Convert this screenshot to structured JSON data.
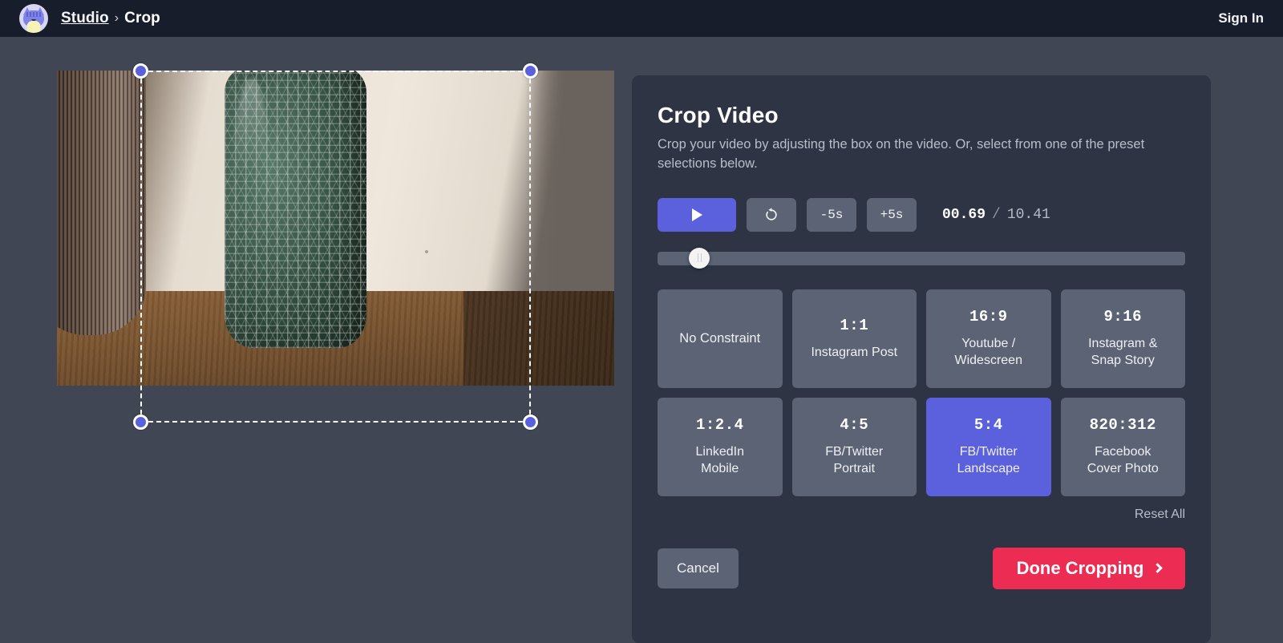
{
  "header": {
    "avatar_icon": "cat-avatar-icon",
    "breadcrumb_root": "Studio",
    "breadcrumb_separator": "›",
    "breadcrumb_current": "Crop",
    "sign_in": "Sign In"
  },
  "stage": {
    "scene_description": "Green textured ceramic vase on wooden table with ribbed brown vase at left"
  },
  "panel": {
    "title": "Crop Video",
    "subtitle": "Crop your video by adjusting the box on the video. Or, select from one of the preset selections below.",
    "controls": {
      "play_icon": "play-icon",
      "restart_icon": "restart-icon",
      "back5_label": "-5s",
      "forward5_label": "+5s",
      "current_time": "00.69",
      "time_separator": "/",
      "duration": "10.41"
    },
    "scrubber": {
      "position_percent": 6
    },
    "presets": [
      {
        "ratio": "",
        "name": "No Constraint",
        "active": false
      },
      {
        "ratio": "1:1",
        "name": "Instagram Post",
        "active": false
      },
      {
        "ratio": "16:9",
        "name": "Youtube /\nWidescreen",
        "active": false
      },
      {
        "ratio": "9:16",
        "name": "Instagram &\nSnap Story",
        "active": false
      },
      {
        "ratio": "1:2.4",
        "name": "LinkedIn\nMobile",
        "active": false
      },
      {
        "ratio": "4:5",
        "name": "FB/Twitter\nPortrait",
        "active": false
      },
      {
        "ratio": "5:4",
        "name": "FB/Twitter\nLandscape",
        "active": true
      },
      {
        "ratio": "820:312",
        "name": "Facebook\nCover Photo",
        "active": false
      }
    ],
    "reset_all": "Reset All",
    "cancel": "Cancel",
    "done": "Done Cropping"
  },
  "colors": {
    "accent_blue": "#5b61dd",
    "accent_red": "#ec2c52",
    "panel_bg": "#2e3444",
    "page_bg": "#404654",
    "topbar_bg": "#181d2b",
    "control_bg": "#5c6374"
  }
}
